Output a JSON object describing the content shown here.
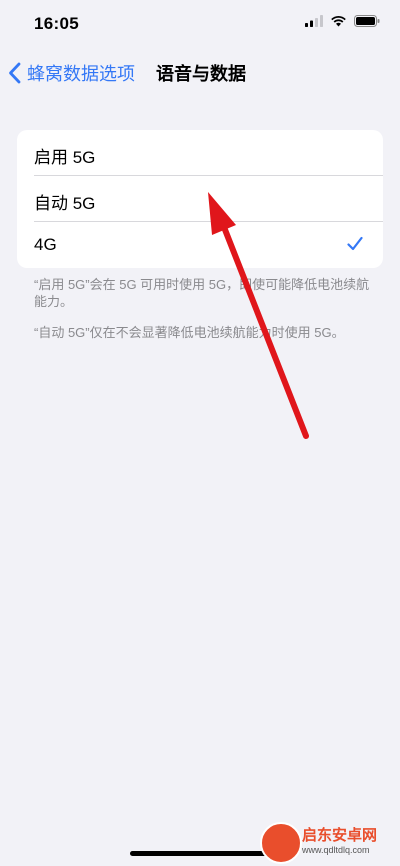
{
  "status_bar": {
    "time": "16:05"
  },
  "nav": {
    "back_label": "蜂窝数据选项",
    "title": "语音与数据"
  },
  "options": [
    {
      "label": "启用 5G",
      "selected": false
    },
    {
      "label": "自动 5G",
      "selected": false
    },
    {
      "label": "4G",
      "selected": true
    }
  ],
  "footnotes": [
    "“启用 5G”会在 5G 可用时使用 5G，即使可能降低电池续航能力。",
    "“自动 5G”仅在不会显著降低电池续航能力时使用 5G。"
  ],
  "watermark": {
    "title": "启东安卓网",
    "subtitle": "www.qdltdlq.com"
  },
  "colors": {
    "accent": "#3478f6",
    "arrow": "#e0161b",
    "background": "#f2f2f7"
  }
}
